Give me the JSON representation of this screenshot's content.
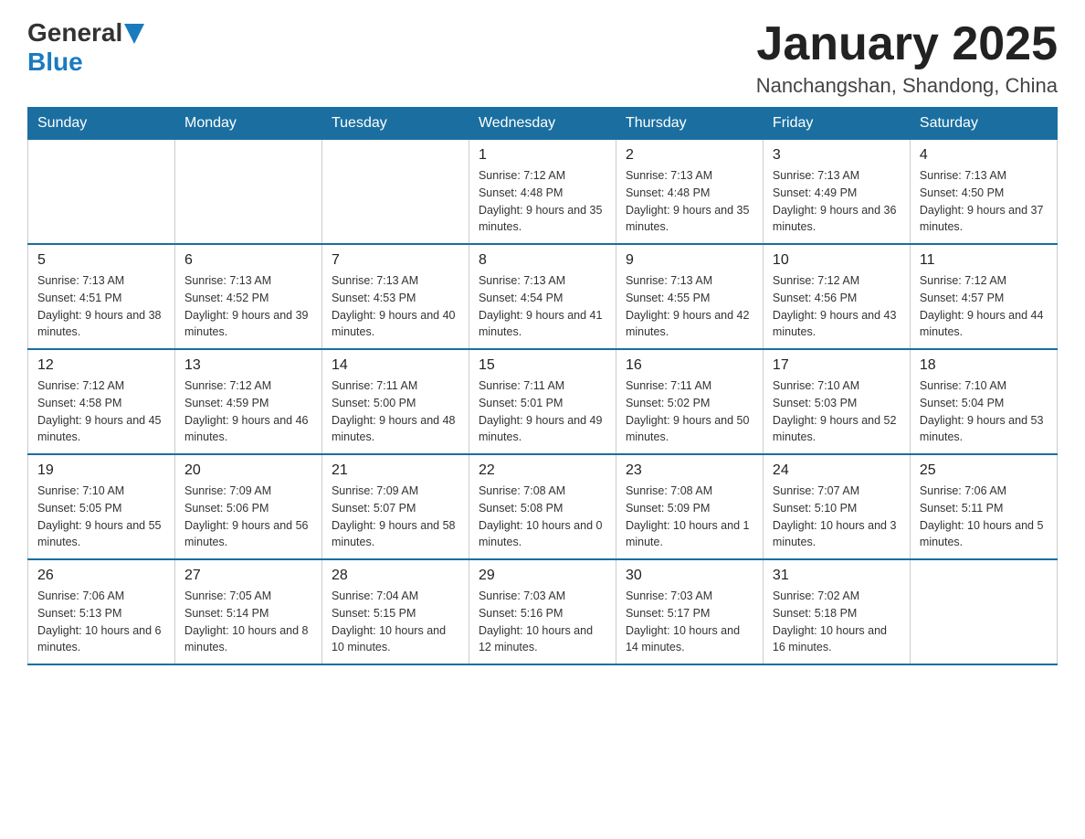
{
  "header": {
    "logo_general": "General",
    "logo_blue": "Blue",
    "month_title": "January 2025",
    "location": "Nanchangshan, Shandong, China"
  },
  "days_of_week": [
    "Sunday",
    "Monday",
    "Tuesday",
    "Wednesday",
    "Thursday",
    "Friday",
    "Saturday"
  ],
  "weeks": [
    [
      {
        "day": "",
        "info": ""
      },
      {
        "day": "",
        "info": ""
      },
      {
        "day": "",
        "info": ""
      },
      {
        "day": "1",
        "info": "Sunrise: 7:12 AM\nSunset: 4:48 PM\nDaylight: 9 hours\nand 35 minutes."
      },
      {
        "day": "2",
        "info": "Sunrise: 7:13 AM\nSunset: 4:48 PM\nDaylight: 9 hours\nand 35 minutes."
      },
      {
        "day": "3",
        "info": "Sunrise: 7:13 AM\nSunset: 4:49 PM\nDaylight: 9 hours\nand 36 minutes."
      },
      {
        "day": "4",
        "info": "Sunrise: 7:13 AM\nSunset: 4:50 PM\nDaylight: 9 hours\nand 37 minutes."
      }
    ],
    [
      {
        "day": "5",
        "info": "Sunrise: 7:13 AM\nSunset: 4:51 PM\nDaylight: 9 hours\nand 38 minutes."
      },
      {
        "day": "6",
        "info": "Sunrise: 7:13 AM\nSunset: 4:52 PM\nDaylight: 9 hours\nand 39 minutes."
      },
      {
        "day": "7",
        "info": "Sunrise: 7:13 AM\nSunset: 4:53 PM\nDaylight: 9 hours\nand 40 minutes."
      },
      {
        "day": "8",
        "info": "Sunrise: 7:13 AM\nSunset: 4:54 PM\nDaylight: 9 hours\nand 41 minutes."
      },
      {
        "day": "9",
        "info": "Sunrise: 7:13 AM\nSunset: 4:55 PM\nDaylight: 9 hours\nand 42 minutes."
      },
      {
        "day": "10",
        "info": "Sunrise: 7:12 AM\nSunset: 4:56 PM\nDaylight: 9 hours\nand 43 minutes."
      },
      {
        "day": "11",
        "info": "Sunrise: 7:12 AM\nSunset: 4:57 PM\nDaylight: 9 hours\nand 44 minutes."
      }
    ],
    [
      {
        "day": "12",
        "info": "Sunrise: 7:12 AM\nSunset: 4:58 PM\nDaylight: 9 hours\nand 45 minutes."
      },
      {
        "day": "13",
        "info": "Sunrise: 7:12 AM\nSunset: 4:59 PM\nDaylight: 9 hours\nand 46 minutes."
      },
      {
        "day": "14",
        "info": "Sunrise: 7:11 AM\nSunset: 5:00 PM\nDaylight: 9 hours\nand 48 minutes."
      },
      {
        "day": "15",
        "info": "Sunrise: 7:11 AM\nSunset: 5:01 PM\nDaylight: 9 hours\nand 49 minutes."
      },
      {
        "day": "16",
        "info": "Sunrise: 7:11 AM\nSunset: 5:02 PM\nDaylight: 9 hours\nand 50 minutes."
      },
      {
        "day": "17",
        "info": "Sunrise: 7:10 AM\nSunset: 5:03 PM\nDaylight: 9 hours\nand 52 minutes."
      },
      {
        "day": "18",
        "info": "Sunrise: 7:10 AM\nSunset: 5:04 PM\nDaylight: 9 hours\nand 53 minutes."
      }
    ],
    [
      {
        "day": "19",
        "info": "Sunrise: 7:10 AM\nSunset: 5:05 PM\nDaylight: 9 hours\nand 55 minutes."
      },
      {
        "day": "20",
        "info": "Sunrise: 7:09 AM\nSunset: 5:06 PM\nDaylight: 9 hours\nand 56 minutes."
      },
      {
        "day": "21",
        "info": "Sunrise: 7:09 AM\nSunset: 5:07 PM\nDaylight: 9 hours\nand 58 minutes."
      },
      {
        "day": "22",
        "info": "Sunrise: 7:08 AM\nSunset: 5:08 PM\nDaylight: 10 hours\nand 0 minutes."
      },
      {
        "day": "23",
        "info": "Sunrise: 7:08 AM\nSunset: 5:09 PM\nDaylight: 10 hours\nand 1 minute."
      },
      {
        "day": "24",
        "info": "Sunrise: 7:07 AM\nSunset: 5:10 PM\nDaylight: 10 hours\nand 3 minutes."
      },
      {
        "day": "25",
        "info": "Sunrise: 7:06 AM\nSunset: 5:11 PM\nDaylight: 10 hours\nand 5 minutes."
      }
    ],
    [
      {
        "day": "26",
        "info": "Sunrise: 7:06 AM\nSunset: 5:13 PM\nDaylight: 10 hours\nand 6 minutes."
      },
      {
        "day": "27",
        "info": "Sunrise: 7:05 AM\nSunset: 5:14 PM\nDaylight: 10 hours\nand 8 minutes."
      },
      {
        "day": "28",
        "info": "Sunrise: 7:04 AM\nSunset: 5:15 PM\nDaylight: 10 hours\nand 10 minutes."
      },
      {
        "day": "29",
        "info": "Sunrise: 7:03 AM\nSunset: 5:16 PM\nDaylight: 10 hours\nand 12 minutes."
      },
      {
        "day": "30",
        "info": "Sunrise: 7:03 AM\nSunset: 5:17 PM\nDaylight: 10 hours\nand 14 minutes."
      },
      {
        "day": "31",
        "info": "Sunrise: 7:02 AM\nSunset: 5:18 PM\nDaylight: 10 hours\nand 16 minutes."
      },
      {
        "day": "",
        "info": ""
      }
    ]
  ]
}
